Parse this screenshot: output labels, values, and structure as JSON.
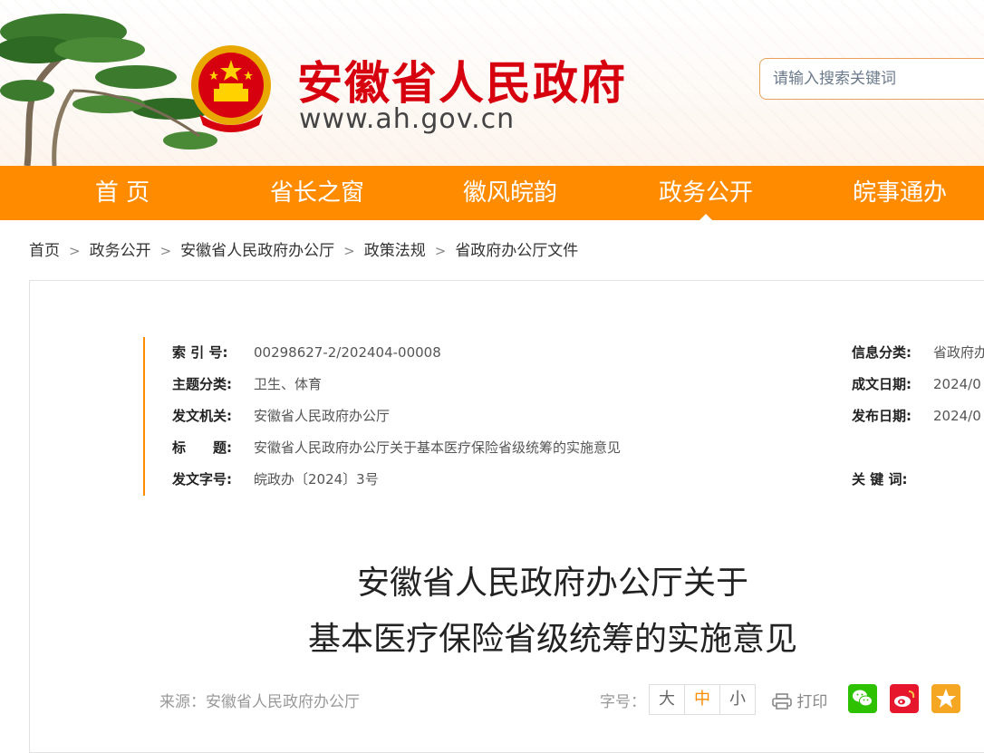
{
  "header": {
    "site_title": "安徽省人民政府",
    "site_url": "www.ah.gov.cn",
    "search_placeholder": "请输入搜索关键词"
  },
  "nav": [
    {
      "label": "首 页"
    },
    {
      "label": "省长之窗"
    },
    {
      "label": "徽风皖韵"
    },
    {
      "label": "政务公开",
      "active": true
    },
    {
      "label": "皖事通办"
    }
  ],
  "breadcrumb": [
    "首页",
    "政务公开",
    "安徽省人民政府办公厅",
    "政策法规",
    "省政府办公厅文件"
  ],
  "meta": {
    "index_label": "索 引 号:",
    "index_value": "00298627-2/202404-00008",
    "topic_label": "主题分类:",
    "topic_value": "卫生、体育",
    "issuer_label": "发文机关:",
    "issuer_value": "安徽省人民政府办公厅",
    "title_label": "标　　题:",
    "title_value": "安徽省人民政府办公厅关于基本医疗保险省级统筹的实施意见",
    "docno_label": "发文字号:",
    "docno_value": "皖政办〔2024〕3号",
    "category_label": "信息分类:",
    "category_value": "省政府办",
    "created_label": "成文日期:",
    "created_value": "2024/0",
    "published_label": "发布日期:",
    "published_value": "2024/0",
    "keywords_label": "关 键 词:"
  },
  "doc": {
    "title_line1": "安徽省人民政府办公厅关于",
    "title_line2": "基本医疗保险省级统筹的实施意见"
  },
  "footer_bar": {
    "source": "来源：安徽省人民政府办公厅",
    "fontsize_label": "字号：",
    "fontsize_options": [
      "大",
      "中",
      "小"
    ],
    "fontsize_selected": "中",
    "print_label": "打印"
  },
  "colors": {
    "accent": "#ff8c00",
    "title_red": "#d7000f",
    "wechat": "#2dc100",
    "weibo": "#e6162d",
    "qzone": "#f5a623"
  }
}
